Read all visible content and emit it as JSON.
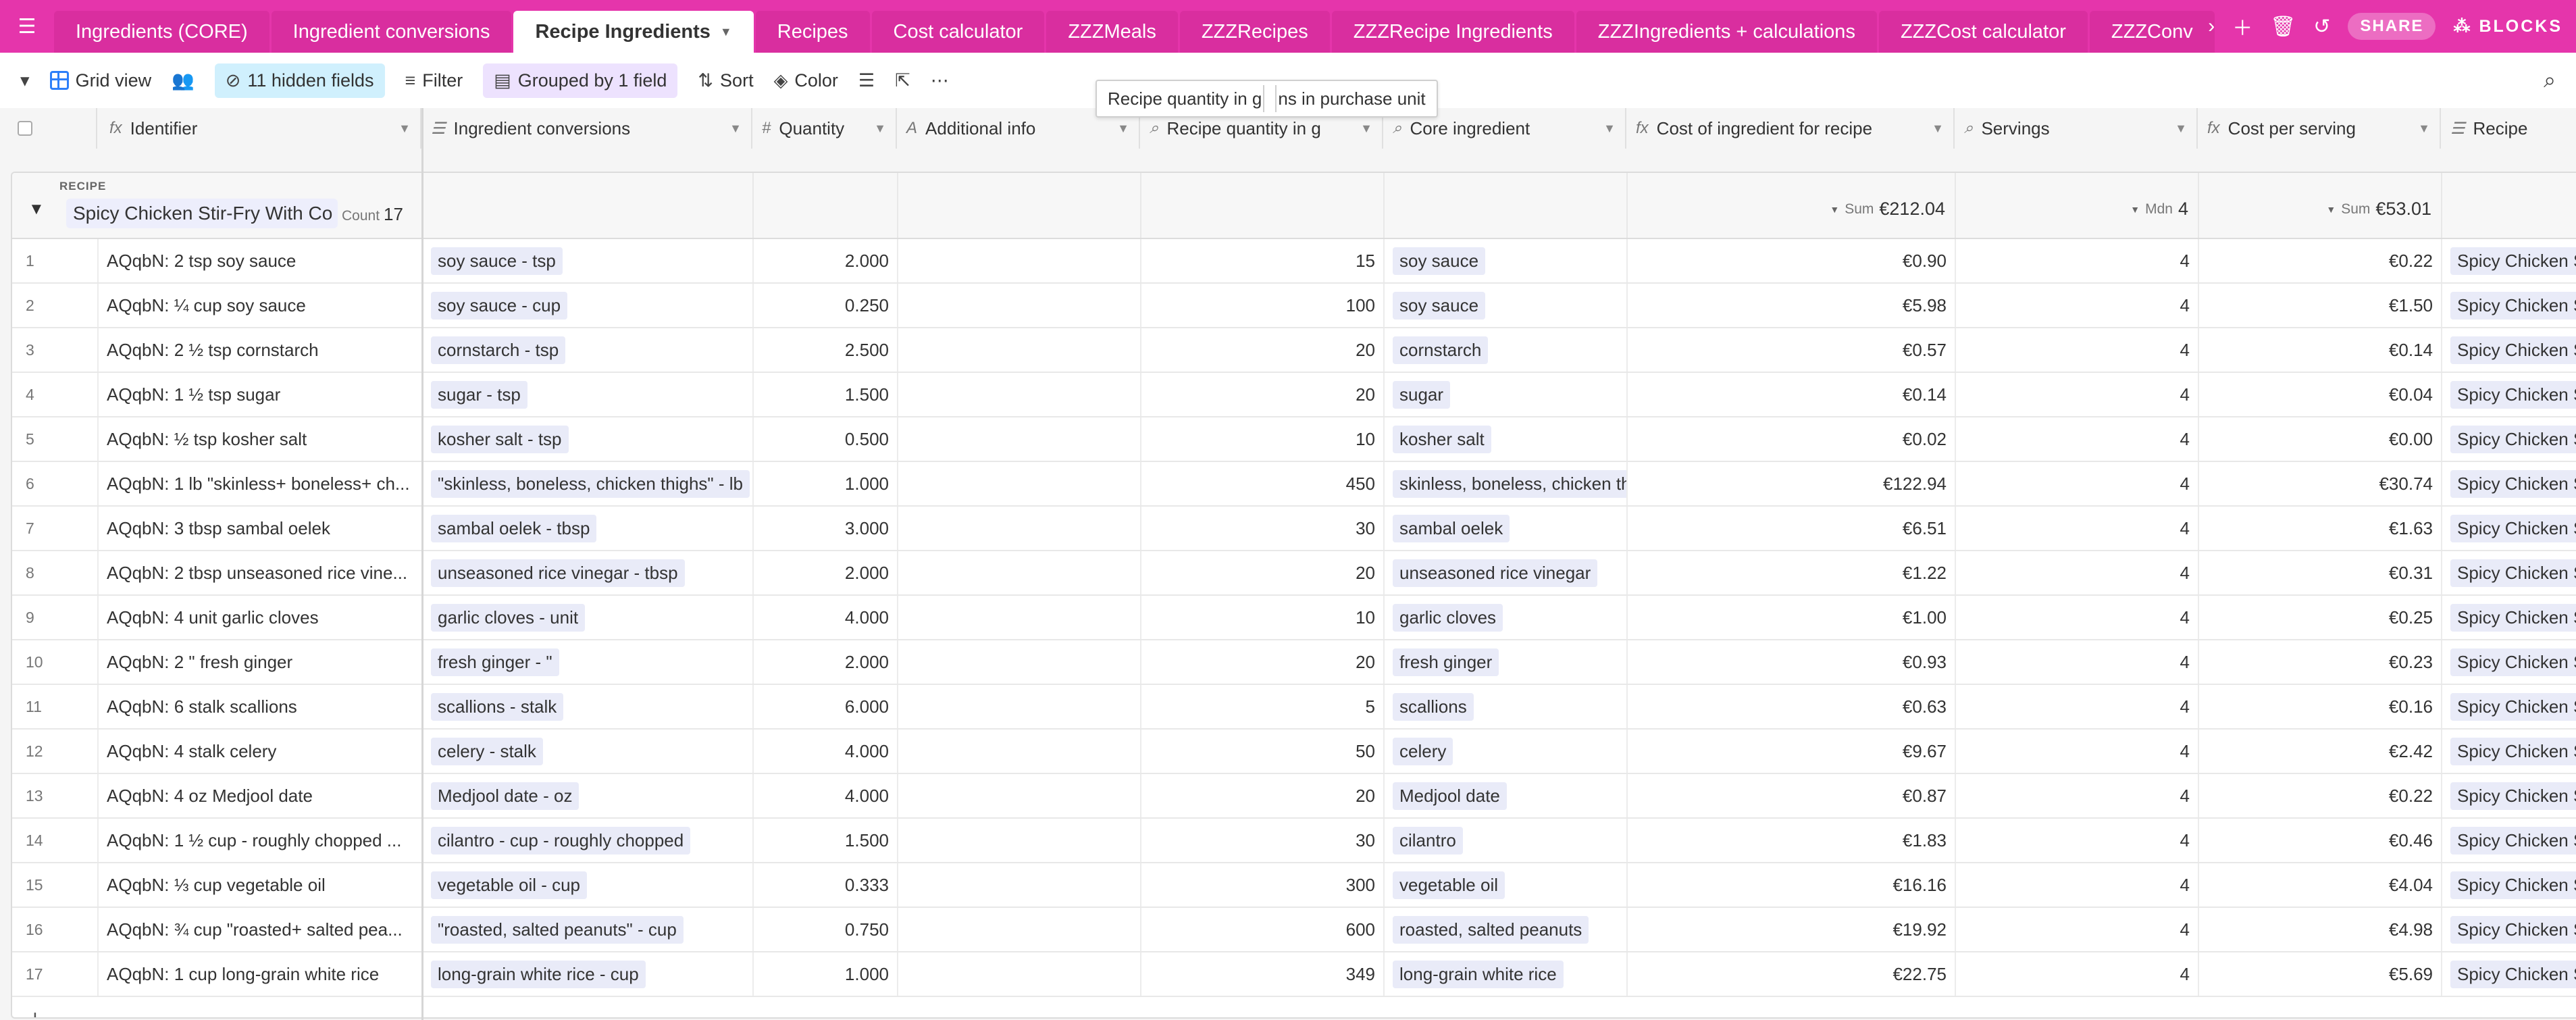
{
  "app": {
    "tabs": [
      {
        "label": "Ingredients (CORE)"
      },
      {
        "label": "Ingredient conversions"
      },
      {
        "label": "Recipe Ingredients"
      },
      {
        "label": "Recipes"
      },
      {
        "label": "Cost calculator"
      },
      {
        "label": "ZZZMeals"
      },
      {
        "label": "ZZZRecipes"
      },
      {
        "label": "ZZZRecipe Ingredients"
      },
      {
        "label": "ZZZIngredients + calculations"
      },
      {
        "label": "ZZZCost calculator"
      },
      {
        "label": "ZZZConv"
      }
    ],
    "share_label": "SHARE",
    "blocks_label": "BLOCKS"
  },
  "toolbar": {
    "view_name": "Grid view",
    "hidden_fields": "11 hidden fields",
    "filter": "Filter",
    "grouped": "Grouped by 1 field",
    "sort": "Sort",
    "color": "Color"
  },
  "tooltip": {
    "left": "Recipe quantity in g",
    "right": "ns in purchase unit"
  },
  "columns": {
    "identifier": "Identifier",
    "ingredient_conversions": "Ingredient conversions",
    "quantity": "Quantity",
    "additional_info": "Additional info",
    "recipe_qty_g": "Recipe quantity in g",
    "core_ingredient": "Core ingredient",
    "cost": "Cost of ingredient for recipe",
    "servings": "Servings",
    "cost_per_serving": "Cost per serving",
    "recipe": "Recipe"
  },
  "group": {
    "label": "RECIPE",
    "title": "Spicy Chicken Stir-Fry With Co",
    "count_label": "Count",
    "count": "17",
    "cost_sum_label": "Sum",
    "cost_sum": "€212.04",
    "servings_label": "Mdn",
    "servings_median": "4",
    "cps_sum_label": "Sum",
    "cps_sum": "€53.01"
  },
  "rows": [
    {
      "n": "1",
      "id": "AQqbN: 2 tsp soy sauce",
      "conv": "soy sauce - tsp",
      "qty": "2.000",
      "g": "15",
      "core": "soy sauce",
      "cost": "€0.90",
      "serv": "4",
      "cps": "€0.22",
      "recipe": "Spicy Chicken S"
    },
    {
      "n": "2",
      "id": "AQqbN: ¼ cup soy sauce",
      "conv": "soy sauce - cup",
      "qty": "0.250",
      "g": "100",
      "core": "soy sauce",
      "cost": "€5.98",
      "serv": "4",
      "cps": "€1.50",
      "recipe": "Spicy Chicken S"
    },
    {
      "n": "3",
      "id": "AQqbN: 2 ½ tsp cornstarch",
      "conv": "cornstarch - tsp",
      "qty": "2.500",
      "g": "20",
      "core": "cornstarch",
      "cost": "€0.57",
      "serv": "4",
      "cps": "€0.14",
      "recipe": "Spicy Chicken S"
    },
    {
      "n": "4",
      "id": "AQqbN: 1 ½ tsp sugar",
      "conv": "sugar - tsp",
      "qty": "1.500",
      "g": "20",
      "core": "sugar",
      "cost": "€0.14",
      "serv": "4",
      "cps": "€0.04",
      "recipe": "Spicy Chicken S"
    },
    {
      "n": "5",
      "id": "AQqbN: ½ tsp kosher salt",
      "conv": "kosher salt - tsp",
      "qty": "0.500",
      "g": "10",
      "core": "kosher salt",
      "cost": "€0.02",
      "serv": "4",
      "cps": "€0.00",
      "recipe": "Spicy Chicken S"
    },
    {
      "n": "6",
      "id": "AQqbN: 1 lb \"skinless+ boneless+ ch...",
      "conv": "\"skinless, boneless, chicken thighs\" - lb",
      "qty": "1.000",
      "g": "450",
      "core": "skinless, boneless, chicken th",
      "cost": "€122.94",
      "serv": "4",
      "cps": "€30.74",
      "recipe": "Spicy Chicken S"
    },
    {
      "n": "7",
      "id": "AQqbN: 3 tbsp sambal oelek",
      "conv": "sambal oelek - tbsp",
      "qty": "3.000",
      "g": "30",
      "core": "sambal oelek",
      "cost": "€6.51",
      "serv": "4",
      "cps": "€1.63",
      "recipe": "Spicy Chicken S"
    },
    {
      "n": "8",
      "id": "AQqbN: 2 tbsp unseasoned rice vine...",
      "conv": "unseasoned rice vinegar - tbsp",
      "qty": "2.000",
      "g": "20",
      "core": "unseasoned rice vinegar",
      "cost": "€1.22",
      "serv": "4",
      "cps": "€0.31",
      "recipe": "Spicy Chicken S"
    },
    {
      "n": "9",
      "id": "AQqbN: 4 unit garlic cloves",
      "conv": "garlic cloves - unit",
      "qty": "4.000",
      "g": "10",
      "core": "garlic cloves",
      "cost": "€1.00",
      "serv": "4",
      "cps": "€0.25",
      "recipe": "Spicy Chicken S"
    },
    {
      "n": "10",
      "id": "AQqbN: 2 \" fresh ginger",
      "conv": "fresh ginger - \"",
      "qty": "2.000",
      "g": "20",
      "core": "fresh ginger",
      "cost": "€0.93",
      "serv": "4",
      "cps": "€0.23",
      "recipe": "Spicy Chicken S"
    },
    {
      "n": "11",
      "id": "AQqbN: 6 stalk scallions",
      "conv": "scallions - stalk",
      "qty": "6.000",
      "g": "5",
      "core": "scallions",
      "cost": "€0.63",
      "serv": "4",
      "cps": "€0.16",
      "recipe": "Spicy Chicken S"
    },
    {
      "n": "12",
      "id": "AQqbN: 4 stalk celery",
      "conv": "celery - stalk",
      "qty": "4.000",
      "g": "50",
      "core": "celery",
      "cost": "€9.67",
      "serv": "4",
      "cps": "€2.42",
      "recipe": "Spicy Chicken S"
    },
    {
      "n": "13",
      "id": "AQqbN: 4 oz Medjool date",
      "conv": "Medjool date - oz",
      "qty": "4.000",
      "g": "20",
      "core": "Medjool date",
      "cost": "€0.87",
      "serv": "4",
      "cps": "€0.22",
      "recipe": "Spicy Chicken S"
    },
    {
      "n": "14",
      "id": "AQqbN: 1 ½ cup - roughly chopped ...",
      "conv": "cilantro - cup - roughly chopped",
      "qty": "1.500",
      "g": "30",
      "core": "cilantro",
      "cost": "€1.83",
      "serv": "4",
      "cps": "€0.46",
      "recipe": "Spicy Chicken S"
    },
    {
      "n": "15",
      "id": "AQqbN: ⅓ cup vegetable oil",
      "conv": "vegetable oil - cup",
      "qty": "0.333",
      "g": "300",
      "core": "vegetable oil",
      "cost": "€16.16",
      "serv": "4",
      "cps": "€4.04",
      "recipe": "Spicy Chicken S"
    },
    {
      "n": "16",
      "id": "AQqbN: ¾ cup \"roasted+ salted pea...",
      "conv": "\"roasted, salted peanuts\" - cup",
      "qty": "0.750",
      "g": "600",
      "core": "roasted, salted peanuts",
      "cost": "€19.92",
      "serv": "4",
      "cps": "€4.98",
      "recipe": "Spicy Chicken S"
    },
    {
      "n": "17",
      "id": "AQqbN: 1 cup long-grain white rice",
      "conv": "long-grain white rice - cup",
      "qty": "1.000",
      "g": "349",
      "core": "long-grain white rice",
      "cost": "€22.75",
      "serv": "4",
      "cps": "€5.69",
      "recipe": "Spicy Chicken S"
    }
  ],
  "add_row_label": "+",
  "colors": {
    "brand_pink": "#e535ab",
    "chip_bg": "#e9ebf8",
    "hidden_fields_bg": "#d0f0fd",
    "grouped_bg": "#ede2fe"
  }
}
